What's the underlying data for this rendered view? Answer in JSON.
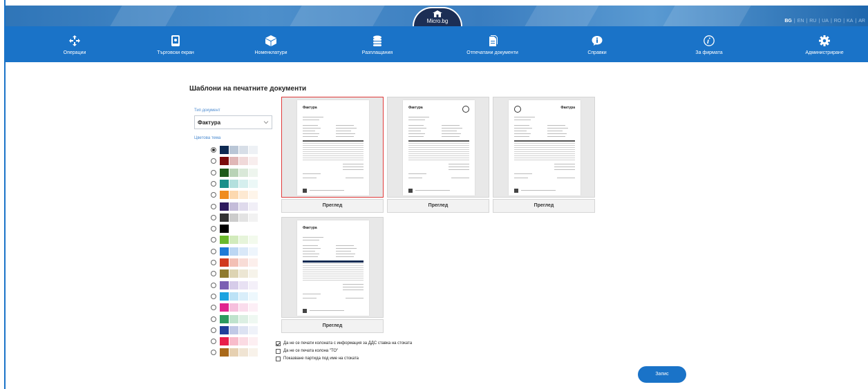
{
  "header": {
    "logo_text": "Micro.bg",
    "languages": [
      {
        "code": "BG",
        "active": true
      },
      {
        "code": "EN",
        "active": false
      },
      {
        "code": "RU",
        "active": false
      },
      {
        "code": "UA",
        "active": false
      },
      {
        "code": "RO",
        "active": false
      },
      {
        "code": "KA",
        "active": false
      },
      {
        "code": "AR",
        "active": false
      }
    ]
  },
  "nav": {
    "items": [
      {
        "label": "Операции",
        "icon": "move-arrows-icon"
      },
      {
        "label": "Търговски екран",
        "icon": "tablet-icon"
      },
      {
        "label": "Номенклатури",
        "icon": "box-icon"
      },
      {
        "label": "Разплащания",
        "icon": "coins-stack-icon"
      },
      {
        "label": "Отпечатани документи",
        "icon": "documents-icon"
      },
      {
        "label": "Справки",
        "icon": "info-bubble-icon"
      },
      {
        "label": "За фирмата",
        "icon": "info-circle-icon"
      },
      {
        "label": "Администриране",
        "icon": "gear-icon"
      }
    ]
  },
  "content": {
    "title": "Шаблони на печатните документи",
    "doc_type_label": "Тип документ",
    "doc_type_value": "Фактура",
    "color_theme_label": "Цветова тема",
    "preview_label": "Преглед",
    "sheet_title": "Фактура",
    "save_label": "Запис"
  },
  "themes": [
    {
      "colors": [
        "#0d2a52",
        "#b9c6d6",
        "#d7dee7",
        "#eef1f5"
      ],
      "checked": true
    },
    {
      "colors": [
        "#7a0c0c",
        "#e0b7b7",
        "#f0d9d9",
        "#f8eeee"
      ],
      "checked": false
    },
    {
      "colors": [
        "#1d5a1a",
        "#b9d3b7",
        "#d9e8d8",
        "#eef5ee"
      ],
      "checked": false
    },
    {
      "colors": [
        "#1a8f8a",
        "#b3e0de",
        "#d5efee",
        "#ecf8f7"
      ],
      "checked": false
    },
    {
      "colors": [
        "#f08c1e",
        "#fcd9b0",
        "#fde9d2",
        "#fef5ea"
      ],
      "checked": false
    },
    {
      "colors": [
        "#2e1a5e",
        "#c4bcd9",
        "#dfdaec",
        "#f1eff7"
      ],
      "checked": false
    },
    {
      "colors": [
        "#333333",
        "#cccccc",
        "#e3e3e3",
        "#f2f2f2"
      ],
      "checked": false
    },
    {
      "colors": [
        "#000000",
        "#ffffff",
        "#ffffff",
        "#ffffff"
      ],
      "checked": false
    },
    {
      "colors": [
        "#6ab82c",
        "#d2ebbc",
        "#e6f4da",
        "#f3faed"
      ],
      "checked": false
    },
    {
      "colors": [
        "#1e7ad6",
        "#bcd7f3",
        "#d9e8f8",
        "#eef5fc"
      ],
      "checked": false
    },
    {
      "colors": [
        "#d13a1e",
        "#f3c0b5",
        "#f8dcd6",
        "#fcefec"
      ],
      "checked": false
    },
    {
      "colors": [
        "#8f7a2e",
        "#ddd4b3",
        "#ece6d3",
        "#f6f3ea"
      ],
      "checked": false
    },
    {
      "colors": [
        "#7b5fb3",
        "#d6cce9",
        "#e8e1f3",
        "#f4f0f9"
      ],
      "checked": false
    },
    {
      "colors": [
        "#1ca2e0",
        "#bce2f6",
        "#d9eefa",
        "#eef8fd"
      ],
      "checked": false
    },
    {
      "colors": [
        "#e0258e",
        "#f6bfdd",
        "#fadcec",
        "#fdeff6"
      ],
      "checked": false
    },
    {
      "colors": [
        "#2c9a5e",
        "#bfe3cd",
        "#dcefe3",
        "#eff8f2"
      ],
      "checked": false
    },
    {
      "colors": [
        "#213f9a",
        "#c0c9e6",
        "#dce2f2",
        "#eff2f9"
      ],
      "checked": false
    },
    {
      "colors": [
        "#e81e4a",
        "#f8bccb",
        "#fbdbe3",
        "#fdeff2"
      ],
      "checked": false
    },
    {
      "colors": [
        "#a9691a",
        "#e6d0b1",
        "#f0e4d3",
        "#f8f2ea"
      ],
      "checked": false
    }
  ],
  "options": [
    {
      "label": "Да не се печати колоната с информация за ДДС ставка на стоката",
      "checked": true
    },
    {
      "label": "Да не се печата колона \"ТО\"",
      "checked": false
    },
    {
      "label": "Показване партида под име на стоката",
      "checked": false
    }
  ]
}
